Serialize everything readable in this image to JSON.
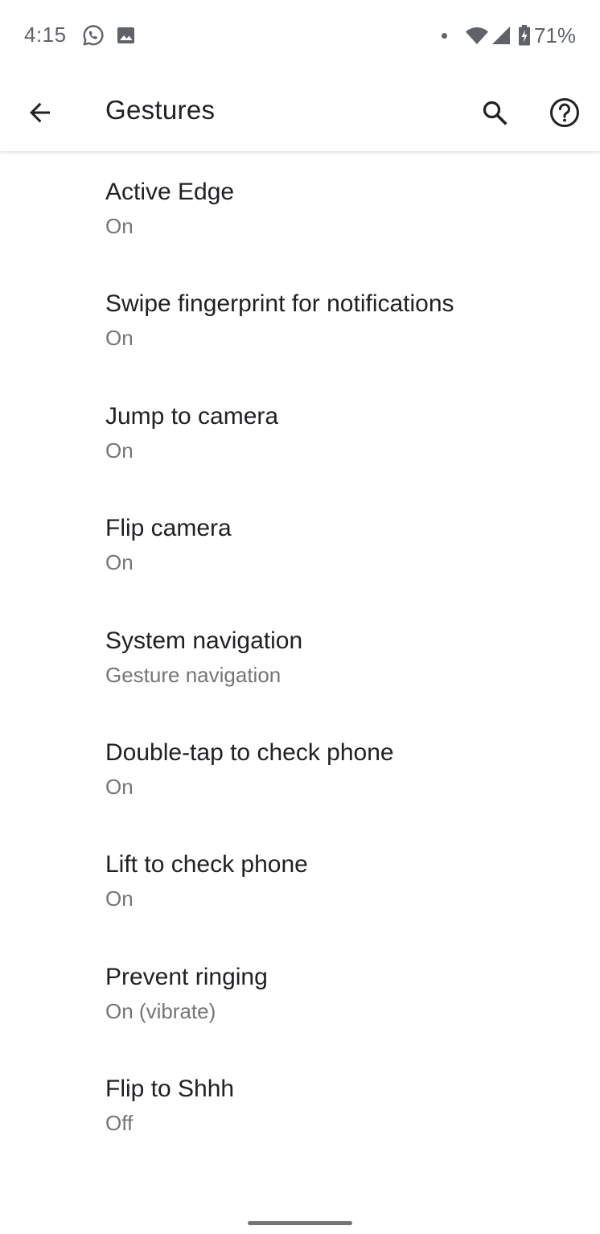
{
  "status_bar": {
    "time": "4:15",
    "left_icons": [
      "whatsapp-icon",
      "image-icon"
    ],
    "right_icons": [
      "notification-dot-icon",
      "wifi-icon",
      "cell-signal-icon",
      "battery-charging-icon"
    ],
    "battery_percent": "71%"
  },
  "app_bar": {
    "title": "Gestures",
    "back_icon": "arrow-back-icon",
    "search_icon": "search-icon",
    "help_icon": "help-circle-icon"
  },
  "settings": [
    {
      "title": "Active Edge",
      "summary": "On"
    },
    {
      "title": "Swipe fingerprint for notifications",
      "summary": "On"
    },
    {
      "title": "Jump to camera",
      "summary": "On"
    },
    {
      "title": "Flip camera",
      "summary": "On"
    },
    {
      "title": "System navigation",
      "summary": "Gesture navigation"
    },
    {
      "title": "Double-tap to check phone",
      "summary": "On"
    },
    {
      "title": "Lift to check phone",
      "summary": "On"
    },
    {
      "title": "Prevent ringing",
      "summary": "On (vibrate)"
    },
    {
      "title": "Flip to Shhh",
      "summary": "Off"
    }
  ],
  "colors": {
    "primary_text": "#202124",
    "secondary_text": "#757575",
    "icon": "#202124",
    "status_icon": "#5f6368"
  }
}
